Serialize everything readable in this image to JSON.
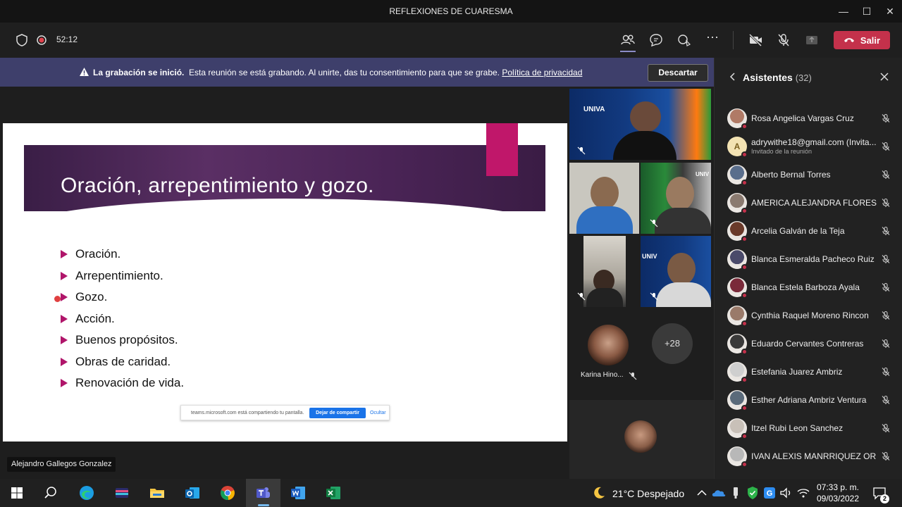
{
  "window": {
    "title": "REFLEXIONES DE CUARESMA"
  },
  "toolbar": {
    "timer": "52:12",
    "leave_label": "Salir"
  },
  "banner": {
    "bold": "La grabación se inició.",
    "text": "Esta reunión se está grabando. Al unirte, das tu consentimiento para que se grabe.",
    "link": "Política de privacidad",
    "dismiss": "Descartar"
  },
  "slide": {
    "title": "Oración, arrepentimiento y gozo.",
    "bullets": [
      "Oración.",
      "Arrepentimiento.",
      "Gozo.",
      "Acción.",
      "Buenos propósitos.",
      "Obras de caridad.",
      "Renovación de vida."
    ],
    "share_bar": {
      "text": "teams.microsoft.com está compartiendo tu pantalla.",
      "stop": "Dejar de compartir",
      "hide": "Ocultar"
    }
  },
  "presenter": "Alejandro Gallegos Gonzalez",
  "tiles": {
    "brand": "UNIVA",
    "brand_partial": "UNIV",
    "karina": "Karina Hino...",
    "more": "+28"
  },
  "panel": {
    "title": "Asistentes",
    "count": "(32)",
    "people": [
      {
        "name": "Rosa Angelica Vargas Cruz",
        "sub": "",
        "color": "#b07a66"
      },
      {
        "name": "adrywithe18@gmail.com (Invita...",
        "sub": "Invitado de la reunión",
        "initial": "A",
        "color": "#f3e3b3"
      },
      {
        "name": "Alberto Bernal Torres",
        "sub": "",
        "color": "#5a6e8c"
      },
      {
        "name": "AMERICA ALEJANDRA FLORES R...",
        "sub": "",
        "color": "#8a7a70"
      },
      {
        "name": "Arcelia Galván de la Teja",
        "sub": "",
        "color": "#6a3a2a"
      },
      {
        "name": "Blanca Esmeralda Pacheco Ruiz",
        "sub": "",
        "color": "#4a4a6a"
      },
      {
        "name": "Blanca Estela Barboza Ayala",
        "sub": "",
        "color": "#7a2a3a"
      },
      {
        "name": "Cynthia Raquel Moreno Rincon",
        "sub": "",
        "color": "#9a7a6a"
      },
      {
        "name": "Eduardo Cervantes Contreras",
        "sub": "",
        "color": "#3a3a3a"
      },
      {
        "name": "Estefania Juarez Ambriz",
        "sub": "",
        "color": "#cfcfcf"
      },
      {
        "name": "Esther Adriana Ambriz Ventura",
        "sub": "",
        "color": "#5a6a7a"
      },
      {
        "name": "Itzel Rubi Leon Sanchez",
        "sub": "",
        "color": "#c8c0b8"
      },
      {
        "name": "IVAN ALEXIS MANRRIQUEZ OR...",
        "sub": "",
        "color": "#b8b8b8"
      }
    ]
  },
  "taskbar": {
    "weather": "21°C  Despejado",
    "time": "07:33 p. m.",
    "date": "09/03/2022",
    "notifications": "2"
  },
  "colors": {
    "leave": "#c4314b",
    "banner": "#3e3f6b",
    "slide_accent": "#c0176a",
    "bullet": "#b0156a"
  }
}
